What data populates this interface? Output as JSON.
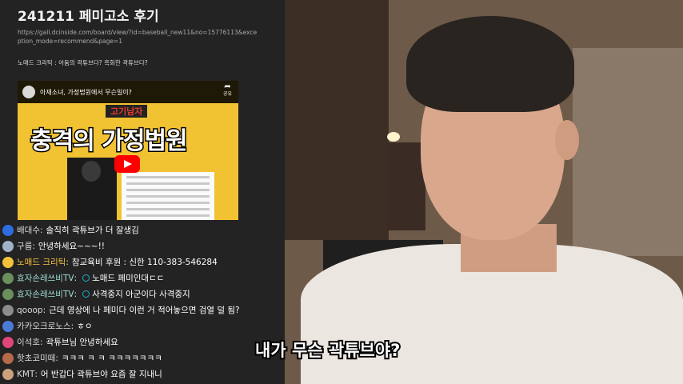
{
  "post": {
    "title": "241211 페미고소 후기",
    "url": "https://gall.dcinside.com/board/view/?id=baseball_new11&no=15776113&exception_mode=recommend&page=1",
    "line": "노매드 크리틱 : 어둠의 곽튜브다? 흑화한 곽튜브다?"
  },
  "video": {
    "title": "아재소녀, 가정법원에서 무슨일이?",
    "share_label": "공유",
    "tag": "고기남자",
    "headline": "충격의 가정법원"
  },
  "chat": [
    {
      "nick": "배대수",
      "text": "솔직히 곽튜브가 더 잘생김",
      "nick_style": "normal",
      "avatar_color": "#2d6cdf",
      "badge": false
    },
    {
      "nick": "구름",
      "text": "안녕하세요~~~!!",
      "nick_style": "normal",
      "avatar_color": "#9fb3c8",
      "badge": false
    },
    {
      "nick": "노매드 크리틱",
      "text": "참교육비 후원 : 신한 110-383-546284",
      "nick_style": "gold",
      "avatar_color": "#f5c23b",
      "badge": false
    },
    {
      "nick": "효자손레쓰비TV",
      "text": "노매드 페미인대ㄷㄷ",
      "nick_style": "teal",
      "avatar_color": "#6b8f5a",
      "badge": true
    },
    {
      "nick": "효자손레쓰비TV",
      "text": "사격중지 아군이다 사격중지",
      "nick_style": "teal",
      "avatar_color": "#6b8f5a",
      "badge": true
    },
    {
      "nick": "qooop",
      "text": "근데 영상에 나 페미다 이런 거 적어놓으면 검열 덜 됨?",
      "nick_style": "normal",
      "avatar_color": "#8c8c8c",
      "badge": false
    },
    {
      "nick": "카카오크로노스",
      "text": "ㅎㅇ",
      "nick_style": "normal",
      "avatar_color": "#4a7bd8",
      "badge": false
    },
    {
      "nick": "이석호",
      "text": "곽튜브님 안녕하세요",
      "nick_style": "normal",
      "avatar_color": "#e0457b",
      "badge": false
    },
    {
      "nick": "핫초코미떼",
      "text": "ㅋㅋㅋ ㅋ ㅋ ㅋㅋㅋㅋㅋㅋㅋ",
      "nick_style": "normal",
      "avatar_color": "#b56a4a",
      "badge": false
    },
    {
      "nick": "KMT",
      "text": "어 반갑다 곽튜브야 요즘 잘 지내니",
      "nick_style": "normal",
      "avatar_color": "#c9a27c",
      "badge": false
    }
  ],
  "subtitle": "내가 무슨 곽튜브야?"
}
